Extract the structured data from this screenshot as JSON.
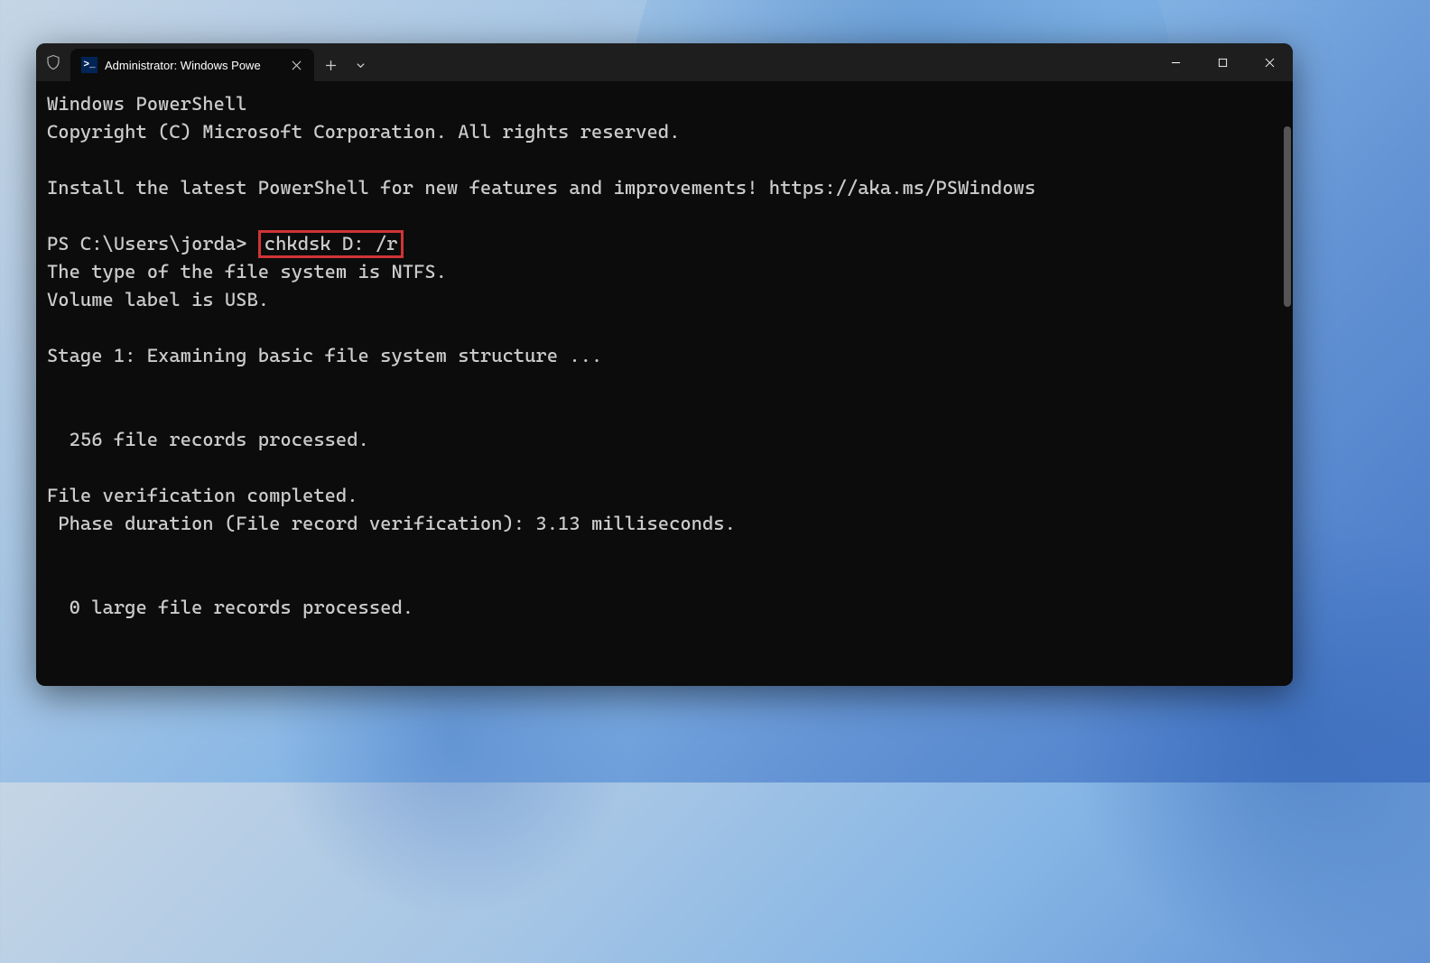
{
  "window": {
    "tab_title": "Administrator: Windows Powe",
    "tab_icon_text": ">_"
  },
  "terminal": {
    "header_line1": "Windows PowerShell",
    "header_line2": "Copyright (C) Microsoft Corporation. All rights reserved.",
    "blank1": "",
    "install_line": "Install the latest PowerShell for new features and improvements! https://aka.ms/PSWindows",
    "blank2": "",
    "prompt": "PS C:\\Users\\jorda> ",
    "command": "chkdsk D: /r",
    "out_line1": "The type of the file system is NTFS.",
    "out_line2": "Volume label is USB.",
    "blank3": "",
    "out_line3": "Stage 1: Examining basic file system structure ...",
    "blank4": "",
    "blank5": "",
    "out_line4": "  256 file records processed.",
    "blank6": "",
    "out_line5": "File verification completed.",
    "out_line6": " Phase duration (File record verification): 3.13 milliseconds.",
    "blank7": "",
    "blank8": "",
    "out_line7": "  0 large file records processed."
  }
}
